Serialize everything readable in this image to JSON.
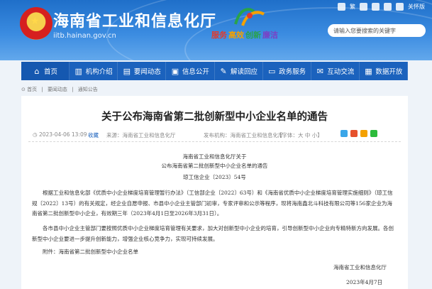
{
  "header": {
    "site_title": "海南省工业和信息化厅",
    "domain": "iitb.hainan.gov.cn",
    "slogan": [
      "服务",
      "高效",
      "创新",
      "廉洁"
    ],
    "top_links": [
      "繁",
      "关怀版"
    ],
    "search_placeholder": "请输入您要搜索的关键字"
  },
  "nav": {
    "items": [
      {
        "label": "首页",
        "icon": "home-icon"
      },
      {
        "label": "机构介绍",
        "icon": "building-icon"
      },
      {
        "label": "要闻动态",
        "icon": "news-icon"
      },
      {
        "label": "信息公开",
        "icon": "info-icon"
      },
      {
        "label": "解读回应",
        "icon": "speech-icon"
      },
      {
        "label": "政务服务",
        "icon": "monitor-icon"
      },
      {
        "label": "互动交流",
        "icon": "chat-icon"
      },
      {
        "label": "数据开放",
        "icon": "data-icon"
      }
    ]
  },
  "breadcrumb": [
    "首页",
    "要闻动态",
    "通知公告"
  ],
  "article": {
    "title": "关于公布海南省第二批创新型中小企业名单的通告",
    "date": "2023-04-06 13:09",
    "collect": "收藏",
    "source": "来源：海南省工业和信息化厅",
    "publisher": "发布机构：海南省工业和信息化厅",
    "font_size": "【字体：大 中 小】",
    "org_line": "海南省工业和信息化厅关于",
    "subject_line": "公布海南省第二批创新型中小企业名单的通告",
    "doc_no": "琼工信企业〔2023〕54号",
    "paragraph1": "根据工业和信息化部《优质中小企业梯度培育管理暂行办法》（工信部企业〔2022〕63号）和《海南省优质中小企业梯度培育管理实施细则》（琼工信规〔2022〕13号）的有关规定，经企业自愿申报、市县中小企业主管部门初审，专家评审和公示等程序，现将海南鑫北斗科技有限公司等156家企业为海南省第二批创新型中小企业，有效期三年（2023年4月1日至2026年3月31日）。",
    "paragraph2": "各市县中小企业主管部门要按照优质中小企业梯度培育管理有关要求，加大对创新型中小企业的培育，引导创新型中小企业向专精特新方向发展。各创新型中小企业要进一步提升创新能力，增强企业核心竞争力，实现可持续发展。",
    "attachment": "附件：海南省第二批创新型中小企业名单",
    "sign_org": "海南省工业和信息化厅",
    "sign_date": "2023年4月7日"
  },
  "colors": {
    "header_blue": "#2a7ad6",
    "nav_blue": "#1b62bd",
    "background": "#eef3f9"
  }
}
